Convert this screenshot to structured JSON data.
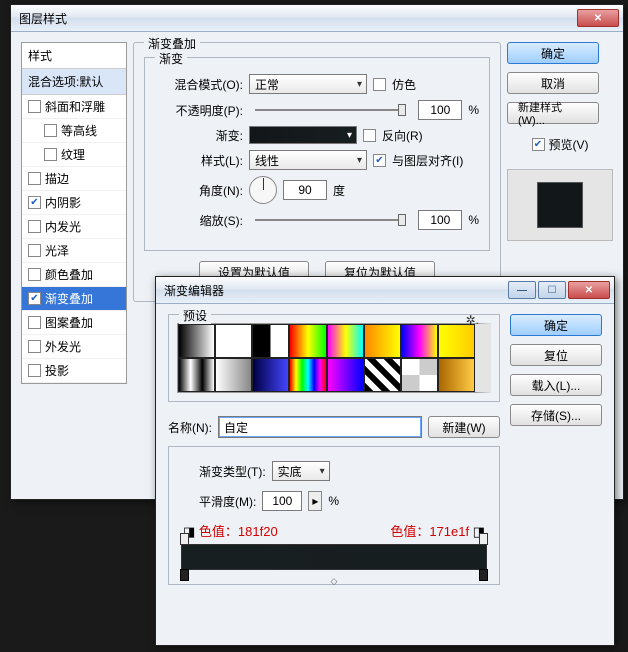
{
  "layerStyle": {
    "title": "图层样式",
    "styles": {
      "header": "样式",
      "sub": "混合选项:默认",
      "items": [
        {
          "label": "斜面和浮雕",
          "checked": false,
          "indent": false
        },
        {
          "label": "等高线",
          "checked": false,
          "indent": true
        },
        {
          "label": "纹理",
          "checked": false,
          "indent": true
        },
        {
          "label": "描边",
          "checked": false,
          "indent": false
        },
        {
          "label": "内阴影",
          "checked": true,
          "indent": false
        },
        {
          "label": "内发光",
          "checked": false,
          "indent": false
        },
        {
          "label": "光泽",
          "checked": false,
          "indent": false
        },
        {
          "label": "颜色叠加",
          "checked": false,
          "indent": false
        },
        {
          "label": "渐变叠加",
          "checked": true,
          "indent": false,
          "selected": true
        },
        {
          "label": "图案叠加",
          "checked": false,
          "indent": false
        },
        {
          "label": "外发光",
          "checked": false,
          "indent": false
        },
        {
          "label": "投影",
          "checked": false,
          "indent": false
        }
      ]
    },
    "gradientOverlay": {
      "groupTitle": "渐变叠加",
      "subTitle": "渐变",
      "blendModeLabel": "混合模式(O):",
      "blendModeValue": "正常",
      "ditherLabel": "仿色",
      "opacityLabel": "不透明度(P):",
      "opacityValue": "100",
      "opacityUnit": "%",
      "gradientLabel": "渐变:",
      "reverseLabel": "反向(R)",
      "styleLabel": "样式(L):",
      "styleValue": "线性",
      "alignLabel": "与图层对齐(I)",
      "angleLabel": "角度(N):",
      "angleValue": "90",
      "angleUnit": "度",
      "scaleLabel": "缩放(S):",
      "scaleValue": "100",
      "scaleUnit": "%",
      "makeDefault": "设置为默认值",
      "resetDefault": "复位为默认值"
    },
    "buttons": {
      "ok": "确定",
      "cancel": "取消",
      "newStyle": "新建样式(W)...",
      "previewLabel": "预览(V)"
    }
  },
  "gradientEditor": {
    "title": "渐变编辑器",
    "presetsLabel": "预设",
    "buttons": {
      "ok": "确定",
      "reset": "复位",
      "load": "载入(L)...",
      "save": "存储(S)..."
    },
    "nameLabel": "名称(N):",
    "nameValue": "自定",
    "newBtn": "新建(W)",
    "gradTypeLabel": "渐变类型(T):",
    "gradTypeValue": "实底",
    "smoothLabel": "平滑度(M):",
    "smoothValue": "100",
    "smoothUnit": "%",
    "colorLeft": "色值：181f20",
    "colorRight": "色值：171e1f",
    "presetGradients": [
      "linear-gradient(90deg,#000,#fff)",
      "linear-gradient(90deg,#fff,#fff)",
      "linear-gradient(90deg,#000,#000 50%,transparent 50%)",
      "linear-gradient(90deg,#f00,#ff0,#0f0)",
      "linear-gradient(90deg,#f0f,#ff0,#0ff)",
      "linear-gradient(90deg,#f80,#ff0)",
      "linear-gradient(90deg,#00f,#f0f,#ff0)",
      "linear-gradient(90deg,#ff0,#fc0)",
      "linear-gradient(90deg,#000,#fff,#000,#fff)",
      "linear-gradient(90deg,#fff,#888)",
      "linear-gradient(90deg,#004,#44f)",
      "linear-gradient(90deg,#f00,#ff0,#0f0,#0ff,#00f,#f0f,#f00)",
      "linear-gradient(90deg,#f0f,#00f)",
      "repeating-linear-gradient(45deg,#000 0 6px,#fff 6px 12px)",
      "repeating-conic-gradient(#ccc 0 25%,#fff 0 50%)",
      "linear-gradient(90deg,#a60,#fc4)"
    ]
  }
}
